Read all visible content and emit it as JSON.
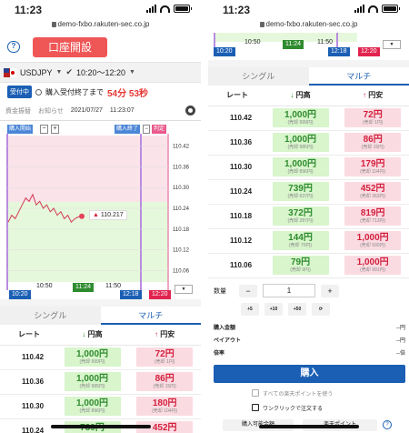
{
  "status": {
    "time": "11:23"
  },
  "url": "demo-fxbo.rakuten-sec.co.jp",
  "header": {
    "open_account": "口座開設"
  },
  "pair": {
    "name": "USDJPY",
    "session": "10:20〜12:20"
  },
  "accept": {
    "badge": "受付中",
    "label": "購入受付終了まで",
    "countdown": "54分 53秒"
  },
  "subnav": {
    "balance": "資金振替",
    "notice": "お知らせ",
    "date": "2021/07/27",
    "time": "11:23:07"
  },
  "chart_left": {
    "btn_start": "購入開始",
    "btn_end": "購入終了",
    "btn_judge": "判定",
    "price_label": "110.217",
    "time_start": "10:20",
    "time_mid1": "10:50",
    "time_now": "11:24",
    "time_mid2": "11:50",
    "time_end1": "12:18",
    "time_end2": "12:20"
  },
  "chart_right": {
    "time_start": "10:20",
    "time_mid1": "10:50",
    "time_now": "11:24",
    "time_mid2": "11:50",
    "time_end1": "12:18",
    "time_end2": "12:20"
  },
  "chart_data": {
    "type": "line",
    "title": "",
    "xlabel": "",
    "ylabel": "",
    "yticks": [
      "110.42",
      "110.36",
      "110.30",
      "110.24",
      "110.18",
      "110.12",
      "110.06"
    ],
    "xticks": [
      "10:50",
      "11:24",
      "11:50"
    ],
    "ylim": [
      110.03,
      110.45
    ],
    "current_price": 110.217,
    "series": [
      {
        "name": "",
        "values": [
          110.2,
          110.22,
          110.21,
          110.23,
          110.25,
          110.27,
          110.26,
          110.28,
          110.25,
          110.26,
          110.24,
          110.25,
          110.23,
          110.24,
          110.22,
          110.23,
          110.21,
          110.22,
          110.2,
          110.21,
          110.215,
          110.217
        ]
      }
    ]
  },
  "tabs": {
    "single": "シングル",
    "multi": "マルチ"
  },
  "table": {
    "col_rate": "レート",
    "col_buy": "円高",
    "col_sell": "円安",
    "left_rows": [
      {
        "rate": "110.42",
        "buy": "1,000円",
        "buy_sub": "(売却 999円)",
        "sell": "72円",
        "sell_sub": "(売却 1円)"
      },
      {
        "rate": "110.36",
        "buy": "1,000円",
        "buy_sub": "(売却 985円)",
        "sell": "86円",
        "sell_sub": "(売却 15円)"
      },
      {
        "rate": "110.30",
        "buy": "1,000円",
        "buy_sub": "(売却 896円)",
        "sell": "180円",
        "sell_sub": "(売却 104円)"
      },
      {
        "rate": "110.24",
        "buy": "739円",
        "buy_sub": "",
        "sell": "452円",
        "sell_sub": ""
      }
    ],
    "right_rows": [
      {
        "rate": "110.42",
        "buy": "1,000円",
        "buy_sub": "(売却 999円)",
        "sell": "72円",
        "sell_sub": "(売却 1円)"
      },
      {
        "rate": "110.36",
        "buy": "1,000円",
        "buy_sub": "(売却 985円)",
        "sell": "86円",
        "sell_sub": "(売却 15円)"
      },
      {
        "rate": "110.30",
        "buy": "1,000円",
        "buy_sub": "(売却 896円)",
        "sell": "179円",
        "sell_sub": "(売却 104円)"
      },
      {
        "rate": "110.24",
        "buy": "739円",
        "buy_sub": "(売却 637円)",
        "sell": "452円",
        "sell_sub": "(売却 363円)"
      },
      {
        "rate": "110.18",
        "buy": "372円",
        "buy_sub": "(売却 287円)",
        "sell": "819円",
        "sell_sub": "(売却 713円)"
      },
      {
        "rate": "110.12",
        "buy": "144円",
        "buy_sub": "(売却 70円)",
        "sell": "1,000円",
        "sell_sub": "(売却 930円)"
      },
      {
        "rate": "110.06",
        "buy": "79円",
        "buy_sub": "(売却 9円)",
        "sell": "1,000円",
        "sell_sub": "(売却 991円)"
      }
    ]
  },
  "order": {
    "qty_label": "数量",
    "minus": "−",
    "plus": "+",
    "qty_value": "1",
    "add5": "+5",
    "add10": "+10",
    "add50": "+50",
    "total_label": "購入金額",
    "total_value": "--円",
    "payout_label": "ペイアウト",
    "payout_value": "--円",
    "ratio_label": "倍率",
    "ratio_value": "--倍",
    "buy_button": "購入",
    "use_points": "すべての楽天ポイントを使う",
    "one_click": "ワンクリックで注文する",
    "available": "購入可能金額",
    "points": "楽天ポイント"
  }
}
